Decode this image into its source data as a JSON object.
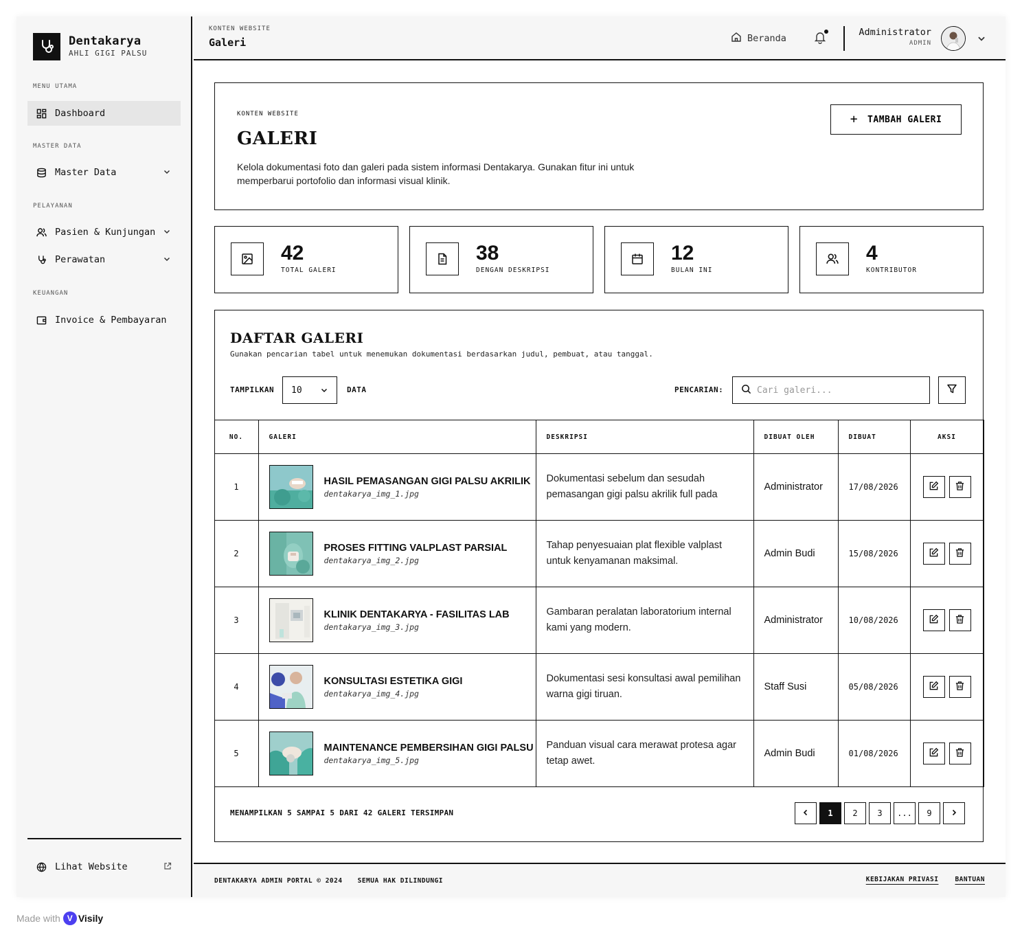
{
  "brand": {
    "name": "Dentakarya",
    "subtitle": "AHLI GIGI PALSU"
  },
  "sidebar": {
    "sections": [
      {
        "label": "MENU UTAMA"
      },
      {
        "label": "MASTER DATA"
      },
      {
        "label": "PELAYANAN"
      },
      {
        "label": "KEUANGAN"
      }
    ],
    "items": [
      {
        "label": "Dashboard",
        "icon": "dashboard-icon"
      },
      {
        "label": "Master Data",
        "icon": "database-icon"
      },
      {
        "label": "Pasien & Kunjungan",
        "icon": "users-icon"
      },
      {
        "label": "Perawatan",
        "icon": "stethoscope-icon"
      },
      {
        "label": "Invoice & Pembayaran",
        "icon": "wallet-icon"
      }
    ],
    "website_link": "Lihat Website"
  },
  "header": {
    "breadcrumb": "KONTEN WEBSITE",
    "title": "Galeri",
    "home_label": "Beranda",
    "user_name": "Administrator",
    "user_role": "ADMIN"
  },
  "hero": {
    "breadcrumb": "KONTEN WEBSITE",
    "title": "GALERI",
    "description": "Kelola dokumentasi foto dan galeri pada sistem informasi Dentakarya. Gunakan fitur ini untuk memperbarui portofolio dan informasi visual klinik.",
    "add_button": "TAMBAH GALERI"
  },
  "stats": [
    {
      "value": "42",
      "label": "TOTAL GALERI",
      "icon": "image-icon"
    },
    {
      "value": "38",
      "label": "DENGAN DESKRIPSI",
      "icon": "file-text-icon"
    },
    {
      "value": "12",
      "label": "BULAN INI",
      "icon": "calendar-icon"
    },
    {
      "value": "4",
      "label": "KONTRIBUTOR",
      "icon": "users-icon"
    }
  ],
  "table": {
    "title": "DAFTAR GALERI",
    "subtitle": "Gunakan pencarian tabel untuk menemukan dokumentasi berdasarkan judul, pembuat, atau tanggal.",
    "show_label": "TAMPILKAN",
    "show_value": "10",
    "data_label": "DATA",
    "search_label": "PENCARIAN:",
    "search_placeholder": "Cari galeri...",
    "columns": [
      "NO.",
      "GALERI",
      "DESKRIPSI",
      "DIBUAT OLEH",
      "DIBUAT",
      "AKSI"
    ],
    "rows": [
      {
        "no": "1",
        "title": "HASIL PEMASANGAN GIGI PALSU AKRILIK",
        "file": "dentakarya_img_1.jpg",
        "desc": "Dokumentasi sebelum dan sesudah pemasangan gigi palsu akrilik full pada",
        "by": "Administrator",
        "date": "17/08/2026"
      },
      {
        "no": "2",
        "title": "PROSES FITTING VALPLAST PARSIAL",
        "file": "dentakarya_img_2.jpg",
        "desc": "Tahap penyesuaian plat flexible valplast untuk kenyamanan maksimal.",
        "by": "Admin Budi",
        "date": "15/08/2026"
      },
      {
        "no": "3",
        "title": "KLINIK DENTAKARYA - FASILITAS LAB",
        "file": "dentakarya_img_3.jpg",
        "desc": "Gambaran peralatan laboratorium internal kami yang modern.",
        "by": "Administrator",
        "date": "10/08/2026"
      },
      {
        "no": "4",
        "title": "KONSULTASI ESTETIKA GIGI",
        "file": "dentakarya_img_4.jpg",
        "desc": "Dokumentasi sesi konsultasi awal pemilihan warna gigi tiruan.",
        "by": "Staff Susi",
        "date": "05/08/2026"
      },
      {
        "no": "5",
        "title": "MAINTENANCE PEMBERSIHAN GIGI PALSU",
        "file": "dentakarya_img_5.jpg",
        "desc": "Panduan visual cara merawat protesa agar tetap awet.",
        "by": "Admin Budi",
        "date": "01/08/2026"
      }
    ],
    "footer_info": "MENAMPILKAN 5 SAMPAI 5 DARI 42 GALERI TERSIMPAN",
    "pages": [
      "1",
      "2",
      "3",
      "...",
      "9"
    ],
    "active_page": "1"
  },
  "page_footer": {
    "copyright": "DENTAKARYA ADMIN PORTAL © 2024",
    "rights": "SEMUA HAK DILINDUNGI",
    "links": [
      "KEBIJAKAN PRIVASI",
      "BANTUAN"
    ]
  },
  "made_with": {
    "text": "Made with",
    "brand": "Visily"
  },
  "colors": {
    "ink": "#111111",
    "panel": "#f6f6f6",
    "active_nav": "#e6e6e6",
    "accent": "#4c3ff0",
    "thumb_teal": "#5fb7b0"
  }
}
